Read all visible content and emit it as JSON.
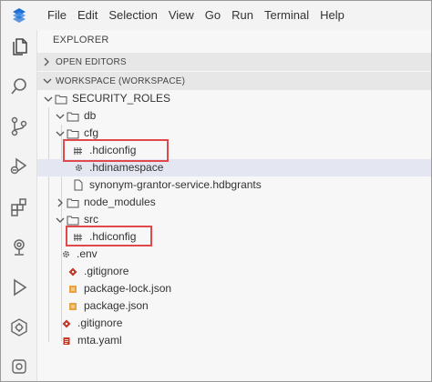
{
  "menu": {
    "items": [
      "File",
      "Edit",
      "Selection",
      "View",
      "Go",
      "Run",
      "Terminal",
      "Help"
    ]
  },
  "activity_bar": {
    "icons": [
      "explorer-icon",
      "search-icon",
      "source-control-icon",
      "run-debug-icon",
      "extensions-icon",
      "remote-icon",
      "run-icon",
      "package-icon",
      "settings-icon"
    ]
  },
  "explorer": {
    "title": "EXPLORER",
    "open_editors": "OPEN EDITORS",
    "workspace": "WORKSPACE (WORKSPACE)",
    "tree": [
      {
        "label": "SECURITY_ROLES",
        "type": "folder",
        "open": true
      },
      {
        "label": "db",
        "type": "folder",
        "open": true
      },
      {
        "label": "cfg",
        "type": "folder",
        "open": true
      },
      {
        "label": ".hdiconfig",
        "type": "hdiconfig"
      },
      {
        "label": ".hdinamespace",
        "type": "gear"
      },
      {
        "label": "synonym-grantor-service.hdbgrants",
        "type": "file"
      },
      {
        "label": "node_modules",
        "type": "folder",
        "open": false
      },
      {
        "label": "src",
        "type": "folder",
        "open": true
      },
      {
        "label": ".hdiconfig",
        "type": "hdiconfig"
      },
      {
        "label": ".env",
        "type": "gear"
      },
      {
        "label": ".gitignore",
        "type": "git"
      },
      {
        "label": "package-lock.json",
        "type": "json"
      },
      {
        "label": "package.json",
        "type": "json"
      },
      {
        "label": ".gitignore",
        "type": "git"
      },
      {
        "label": "mta.yaml",
        "type": "yaml"
      }
    ]
  },
  "colors": {
    "highlight_box": "#e0484b",
    "selected_row": "#e4e6f1",
    "git_icon": "#c0392b",
    "json_icon": "#e8a33d",
    "yaml_icon": "#c0392b"
  }
}
